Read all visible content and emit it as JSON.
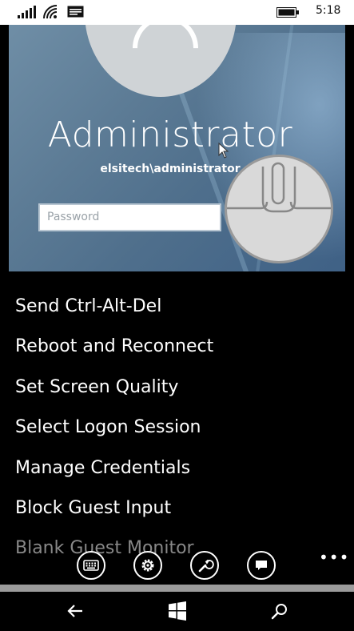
{
  "status_bar": {
    "time": "5:18",
    "icons": [
      "signal-icon",
      "wifi-icon",
      "message-icon",
      "battery-icon"
    ]
  },
  "remote_screen": {
    "user_name": "Administrator",
    "domain_user": "elsitech\\administrator",
    "password_placeholder": "Password",
    "icons": [
      "avatar-icon",
      "mouse-pointer-icon",
      "mouse-icon"
    ]
  },
  "menu": {
    "items": [
      {
        "label": "Send Ctrl-Alt-Del"
      },
      {
        "label": "Reboot and Reconnect"
      },
      {
        "label": "Set Screen Quality"
      },
      {
        "label": "Select Logon Session"
      },
      {
        "label": "Manage Credentials"
      },
      {
        "label": "Block Guest Input"
      },
      {
        "label": "Blank Guest Monitor"
      }
    ]
  },
  "app_bar": {
    "buttons": [
      "keyboard-icon",
      "settings-icon",
      "wrench-icon",
      "chat-icon"
    ],
    "more_label": "•••"
  },
  "nav_bar": {
    "buttons": [
      "back-arrow-icon",
      "windows-start-icon",
      "search-icon"
    ]
  },
  "colors": {
    "background": "#000000",
    "status_bar": "#ffffff",
    "text": "#ffffff",
    "faded_text": "#888888",
    "appbar_strip": "#9b9b9b"
  }
}
